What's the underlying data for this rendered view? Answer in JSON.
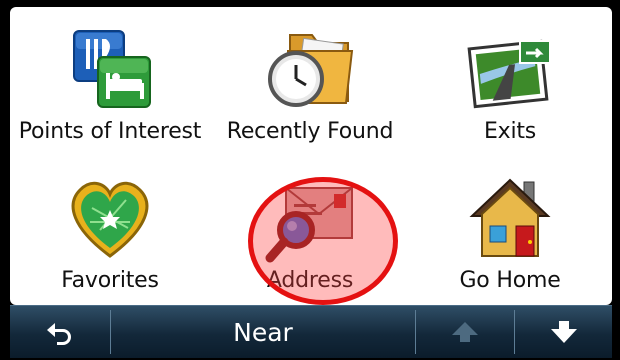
{
  "menu": {
    "items": [
      {
        "label": "Points of Interest",
        "icon": "points-of-interest-icon"
      },
      {
        "label": "Recently Found",
        "icon": "recently-found-icon"
      },
      {
        "label": "Exits",
        "icon": "exits-icon"
      },
      {
        "label": "Favorites",
        "icon": "favorites-icon"
      },
      {
        "label": "Address",
        "icon": "address-icon"
      },
      {
        "label": "Go Home",
        "icon": "go-home-icon"
      }
    ]
  },
  "bottom_bar": {
    "back_icon": "back-arrow-icon",
    "near_label": "Near",
    "up_icon": "scroll-up-icon",
    "down_icon": "scroll-down-icon"
  },
  "colors": {
    "highlight": "#e41111",
    "bar": "#13283a"
  }
}
